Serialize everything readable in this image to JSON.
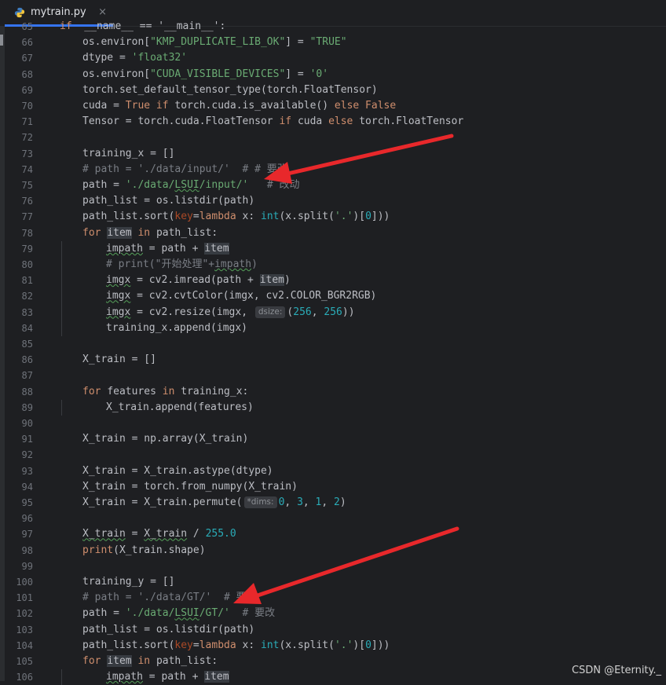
{
  "tab": {
    "filename": "mytrain.py",
    "close_glyph": "×",
    "icon": "python-icon"
  },
  "watermark": "CSDN @Eternity._",
  "lines": [
    {
      "n": "65",
      "indent": 0,
      "tokens": [
        [
          "kw",
          "if"
        ],
        [
          "",
          "  __name__ == '__main__':"
        ]
      ]
    },
    {
      "n": "66",
      "indent": 1,
      "tokens": [
        [
          "",
          "os.environ["
        ],
        [
          "str",
          "\"KMP_DUPLICATE_LIB_OK\""
        ],
        [
          "",
          "] = "
        ],
        [
          "str",
          "\"TRUE\""
        ]
      ]
    },
    {
      "n": "67",
      "indent": 1,
      "tokens": [
        [
          "",
          "dtype = "
        ],
        [
          "str",
          "'float32'"
        ]
      ]
    },
    {
      "n": "68",
      "indent": 1,
      "tokens": [
        [
          "",
          "os.environ["
        ],
        [
          "str",
          "\"CUDA_VISIBLE_DEVICES\""
        ],
        [
          "",
          "] = "
        ],
        [
          "str",
          "'0'"
        ]
      ]
    },
    {
      "n": "69",
      "indent": 1,
      "tokens": [
        [
          "",
          "torch.set_default_tensor_type(torch.FloatTensor)"
        ]
      ]
    },
    {
      "n": "70",
      "indent": 1,
      "tokens": [
        [
          "",
          "cuda = "
        ],
        [
          "kw",
          "True if "
        ],
        [
          "",
          "torch.cuda.is_available() "
        ],
        [
          "kw",
          "else False"
        ]
      ]
    },
    {
      "n": "71",
      "indent": 1,
      "tokens": [
        [
          "",
          "Tensor = torch.cuda.FloatTensor "
        ],
        [
          "kw",
          "if "
        ],
        [
          "",
          "cuda "
        ],
        [
          "kw",
          "else "
        ],
        [
          "",
          "torch.FloatTensor"
        ]
      ]
    },
    {
      "n": "72",
      "indent": 0,
      "tokens": []
    },
    {
      "n": "73",
      "indent": 1,
      "tokens": [
        [
          "",
          "training_x = []"
        ]
      ]
    },
    {
      "n": "74",
      "indent": 1,
      "tokens": [
        [
          "cmt",
          "# path = './data/input/'  # # 要改"
        ]
      ]
    },
    {
      "n": "75",
      "indent": 1,
      "tokens": [
        [
          "",
          "path = "
        ],
        [
          "str",
          "'./data/"
        ],
        [
          "str uline",
          "LSUI"
        ],
        [
          "str",
          "/input/'"
        ],
        [
          "",
          "   "
        ],
        [
          "cmt",
          "# 改动"
        ]
      ]
    },
    {
      "n": "76",
      "indent": 1,
      "tokens": [
        [
          "",
          "path_list = os.listdir(path)"
        ]
      ]
    },
    {
      "n": "77",
      "indent": 1,
      "tokens": [
        [
          "",
          "path_list.sort("
        ],
        [
          "param",
          "key"
        ],
        [
          "",
          "="
        ],
        [
          "kw",
          "lambda "
        ],
        [
          "",
          "x: "
        ],
        [
          "num",
          "int"
        ],
        [
          "",
          "(x.split("
        ],
        [
          "str",
          "'.'"
        ],
        [
          "",
          ")["
        ],
        [
          "num",
          "0"
        ],
        [
          "",
          "]))"
        ]
      ]
    },
    {
      "n": "78",
      "indent": 1,
      "tokens": [
        [
          "kw",
          "for "
        ],
        [
          "hl",
          "item"
        ],
        [
          "kw",
          " in "
        ],
        [
          "",
          "path_list:"
        ]
      ]
    },
    {
      "n": "79",
      "indent": 2,
      "tokens": [
        [
          "uline",
          "impath"
        ],
        [
          "",
          " = path + "
        ],
        [
          "hl",
          "item"
        ]
      ]
    },
    {
      "n": "80",
      "indent": 2,
      "tokens": [
        [
          "cmt",
          "# print(\"开始处理\"+"
        ],
        [
          "cmt uline",
          "impath"
        ],
        [
          "cmt",
          ")"
        ]
      ]
    },
    {
      "n": "81",
      "indent": 2,
      "tokens": [
        [
          "uline",
          "imgx"
        ],
        [
          "",
          " = cv2.imread(path + "
        ],
        [
          "hl",
          "item"
        ],
        [
          "",
          ")"
        ]
      ]
    },
    {
      "n": "82",
      "indent": 2,
      "tokens": [
        [
          "uline",
          "imgx"
        ],
        [
          "",
          " = cv2.cvtColor(imgx, cv2.COLOR_BGR2RGB)"
        ]
      ]
    },
    {
      "n": "83",
      "indent": 2,
      "tokens": [
        [
          "uline",
          "imgx"
        ],
        [
          "",
          " = cv2.resize(imgx, "
        ],
        [
          "hint",
          "dsize:"
        ],
        [
          "",
          "("
        ],
        [
          "num",
          "256"
        ],
        [
          "",
          ", "
        ],
        [
          "num",
          "256"
        ],
        [
          "",
          "))"
        ]
      ]
    },
    {
      "n": "84",
      "indent": 2,
      "tokens": [
        [
          "",
          "training_x.append(imgx)"
        ]
      ]
    },
    {
      "n": "85",
      "indent": 0,
      "tokens": []
    },
    {
      "n": "86",
      "indent": 1,
      "tokens": [
        [
          "",
          "X_train = []"
        ]
      ]
    },
    {
      "n": "87",
      "indent": 0,
      "tokens": []
    },
    {
      "n": "88",
      "indent": 1,
      "tokens": [
        [
          "kw",
          "for "
        ],
        [
          "",
          "features "
        ],
        [
          "kw",
          "in "
        ],
        [
          "",
          "training_x:"
        ]
      ]
    },
    {
      "n": "89",
      "indent": 2,
      "tokens": [
        [
          "",
          "X_train.append(features)"
        ]
      ]
    },
    {
      "n": "90",
      "indent": 0,
      "tokens": []
    },
    {
      "n": "91",
      "indent": 1,
      "tokens": [
        [
          "",
          "X_train = np.array(X_train)"
        ]
      ]
    },
    {
      "n": "92",
      "indent": 0,
      "tokens": []
    },
    {
      "n": "93",
      "indent": 1,
      "tokens": [
        [
          "",
          "X_train = X_train.astype(dtype)"
        ]
      ]
    },
    {
      "n": "94",
      "indent": 1,
      "tokens": [
        [
          "",
          "X_train = torch.from_numpy(X_train)"
        ]
      ]
    },
    {
      "n": "95",
      "indent": 1,
      "tokens": [
        [
          "",
          "X_train = X_train.permute("
        ],
        [
          "hint",
          "*dims:"
        ],
        [
          "num",
          "0"
        ],
        [
          "",
          ", "
        ],
        [
          "num",
          "3"
        ],
        [
          "",
          ", "
        ],
        [
          "num",
          "1"
        ],
        [
          "",
          ", "
        ],
        [
          "num",
          "2"
        ],
        [
          "",
          ")"
        ]
      ]
    },
    {
      "n": "96",
      "indent": 0,
      "tokens": []
    },
    {
      "n": "97",
      "indent": 1,
      "tokens": [
        [
          "uline",
          "X_train"
        ],
        [
          "",
          " = "
        ],
        [
          "uline",
          "X_train"
        ],
        [
          "",
          " / "
        ],
        [
          "num",
          "255.0"
        ]
      ]
    },
    {
      "n": "98",
      "indent": 1,
      "tokens": [
        [
          "kw",
          "print"
        ],
        [
          "",
          "(X_train.shape)"
        ]
      ]
    },
    {
      "n": "99",
      "indent": 0,
      "tokens": []
    },
    {
      "n": "100",
      "indent": 1,
      "tokens": [
        [
          "",
          "training_y = []"
        ]
      ]
    },
    {
      "n": "101",
      "indent": 1,
      "tokens": [
        [
          "cmt",
          "# path = './data/GT/'  # 要改"
        ]
      ]
    },
    {
      "n": "102",
      "indent": 1,
      "tokens": [
        [
          "",
          "path = "
        ],
        [
          "str",
          "'./data/"
        ],
        [
          "str uline",
          "LSUI"
        ],
        [
          "str",
          "/GT/'"
        ],
        [
          "",
          "  "
        ],
        [
          "cmt",
          "# 要改"
        ]
      ]
    },
    {
      "n": "103",
      "indent": 1,
      "tokens": [
        [
          "",
          "path_list = os.listdir(path)"
        ]
      ]
    },
    {
      "n": "104",
      "indent": 1,
      "tokens": [
        [
          "",
          "path_list.sort("
        ],
        [
          "param",
          "key"
        ],
        [
          "",
          "="
        ],
        [
          "kw",
          "lambda "
        ],
        [
          "",
          "x: "
        ],
        [
          "num",
          "int"
        ],
        [
          "",
          "(x.split("
        ],
        [
          "str",
          "'.'"
        ],
        [
          "",
          ")["
        ],
        [
          "num",
          "0"
        ],
        [
          "",
          "]))"
        ]
      ]
    },
    {
      "n": "105",
      "indent": 1,
      "tokens": [
        [
          "kw",
          "for "
        ],
        [
          "hl",
          "item"
        ],
        [
          "kw",
          " in "
        ],
        [
          "",
          "path_list:"
        ]
      ]
    },
    {
      "n": "106",
      "indent": 2,
      "tokens": [
        [
          "uline",
          "impath"
        ],
        [
          "",
          " = path + "
        ],
        [
          "hl",
          "item"
        ]
      ]
    }
  ],
  "annotation_color": "#e8282b"
}
